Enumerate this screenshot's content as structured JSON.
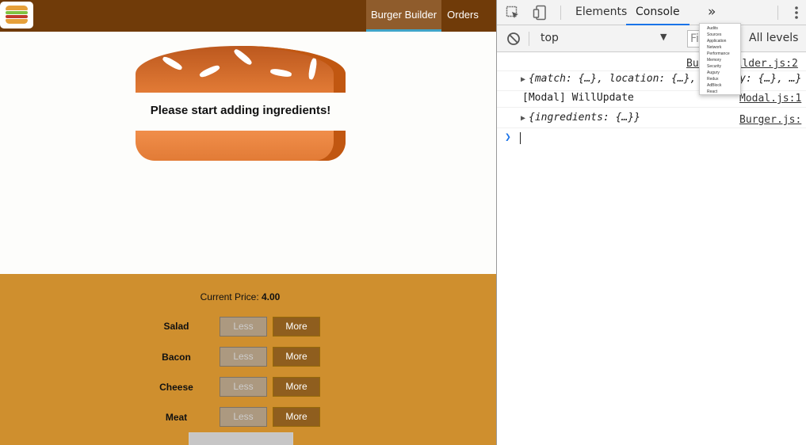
{
  "app": {
    "nav": {
      "burger_builder": "Burger Builder",
      "orders": "Orders"
    },
    "burger": {
      "empty_message": "Please start adding ingredients!"
    },
    "controls": {
      "price_label": "Current Price:",
      "price_value": "4.00",
      "ingredients": [
        {
          "label": "Salad",
          "less": "Less",
          "more": "More"
        },
        {
          "label": "Bacon",
          "less": "Less",
          "more": "More"
        },
        {
          "label": "Cheese",
          "less": "Less",
          "more": "More"
        },
        {
          "label": "Meat",
          "less": "Less",
          "more": "More"
        }
      ]
    }
  },
  "devtools": {
    "tabs": {
      "elements": "Elements",
      "console": "Console",
      "more": "»"
    },
    "context": "top",
    "filter_placeholder": "Filter",
    "levels": "All levels",
    "log": {
      "line1_source": "BurgerBuilder.js:2",
      "line2_text": "{match: {…}, location: {…}, history: {…}, …}",
      "line2_source": "",
      "line3_text": "[Modal] WillUpdate",
      "line3_source": "Modal.js:1",
      "line4_text": "{ingredients: {…}}",
      "line4_source": "Burger.js:"
    },
    "panel_menu": [
      "Audits",
      "Sources",
      "Application",
      "Network",
      "Performance",
      "Memory",
      "Security",
      "Augury",
      "Redux",
      "AdBlock",
      "React"
    ]
  }
}
